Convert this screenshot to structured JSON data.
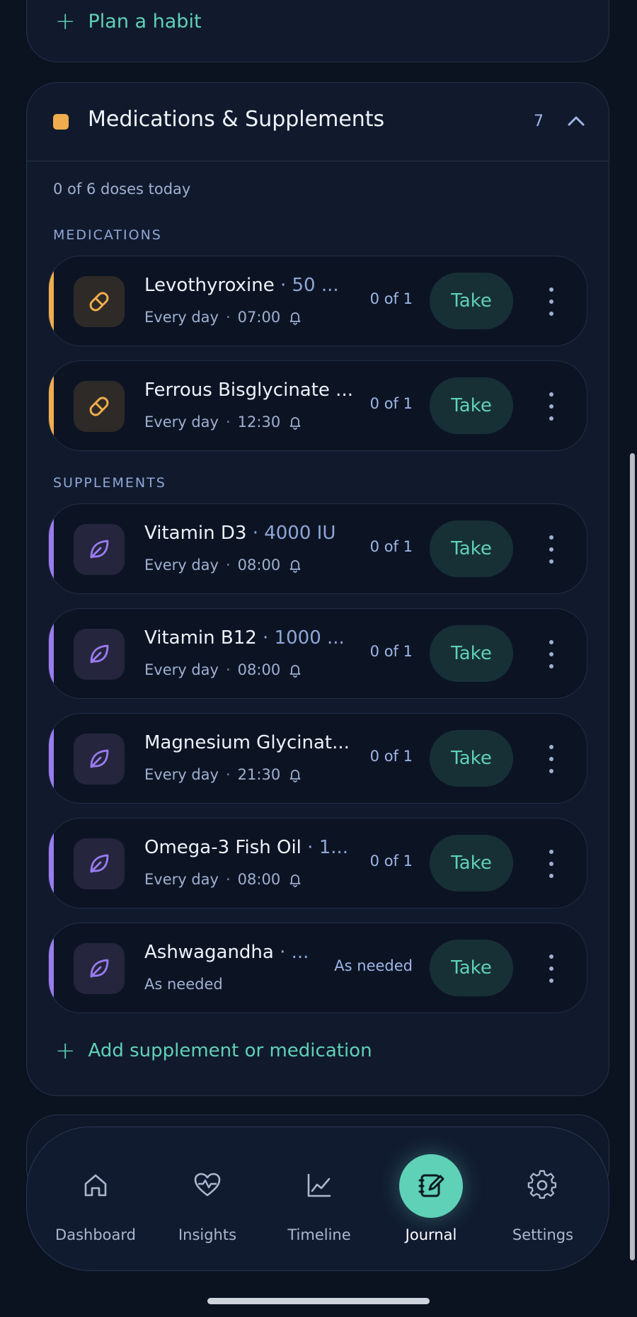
{
  "top": {
    "plan_label": "Plan a habit"
  },
  "section": {
    "title": "Medications & Supplements",
    "count": "7",
    "doses_summary": "0 of 6 doses today",
    "accent_color": "#f0ad4e"
  },
  "labels": {
    "medications": "MEDICATIONS",
    "supplements": "SUPPLEMENTS"
  },
  "items": [
    {
      "name": "Levothyroxine",
      "dose": "50 ...",
      "sub": "Every day",
      "time": "07:00",
      "progress": "0 of 1",
      "take": "Take",
      "kind": "medication"
    },
    {
      "name": "Ferrous Bisglycinate ...",
      "dose": "",
      "sub": "Every day",
      "time": "12:30",
      "progress": "0 of 1",
      "take": "Take",
      "kind": "medication"
    },
    {
      "name": "Vitamin D3",
      "dose": "4000 IU",
      "sub": "Every day",
      "time": "08:00",
      "progress": "0 of 1",
      "take": "Take",
      "kind": "supplement"
    },
    {
      "name": "Vitamin B12",
      "dose": "1000 ...",
      "sub": "Every day",
      "time": "08:00",
      "progress": "0 of 1",
      "take": "Take",
      "kind": "supplement"
    },
    {
      "name": "Magnesium Glycinat...",
      "dose": "",
      "sub": "Every day",
      "time": "21:30",
      "progress": "0 of 1",
      "take": "Take",
      "kind": "supplement"
    },
    {
      "name": "Omega-3 Fish Oil",
      "dose": "1...",
      "sub": "Every day",
      "time": "08:00",
      "progress": "0 of 1",
      "take": "Take",
      "kind": "supplement"
    },
    {
      "name": "Ashwagandha",
      "dose": "...",
      "sub": "As needed",
      "time": "",
      "progress": "As needed",
      "take": "Take",
      "kind": "supplement"
    }
  ],
  "add_label": "Add supplement or medication",
  "colors": {
    "medication": "#f0ad4e",
    "supplement": "#9a7cf0",
    "accent": "#5fd1b7"
  },
  "nav": [
    {
      "label": "Dashboard",
      "icon": "home-icon"
    },
    {
      "label": "Insights",
      "icon": "heart-pulse-icon"
    },
    {
      "label": "Timeline",
      "icon": "chart-line-icon"
    },
    {
      "label": "Journal",
      "icon": "journal-edit-icon",
      "active": true
    },
    {
      "label": "Settings",
      "icon": "gear-icon"
    }
  ]
}
